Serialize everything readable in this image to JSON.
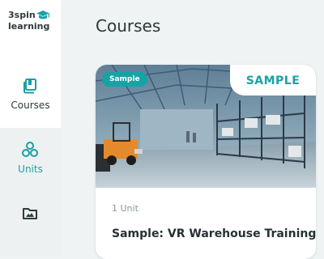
{
  "brand": {
    "line1": "3spin",
    "line2": "learning",
    "icon": "graduation-cap-icon",
    "accent": "#1aa3a8"
  },
  "nav": [
    {
      "label": "Courses",
      "icon": "book-icon",
      "active": true
    },
    {
      "label": "Units",
      "icon": "units-cluster-icon",
      "active": false,
      "color": "#1a9fa8"
    },
    {
      "label": "",
      "icon": "folder-image-icon",
      "active": false
    }
  ],
  "page": {
    "title": "Courses"
  },
  "course_card": {
    "badge": "Sample",
    "corner_label": "SAMPLE",
    "units": "1 Unit",
    "title": "Sample: VR Warehouse Training",
    "image": "warehouse-forklift-scene"
  },
  "colors": {
    "accent": "#17a3a6",
    "background": "#f0f3f3",
    "text": "#2c3638"
  }
}
